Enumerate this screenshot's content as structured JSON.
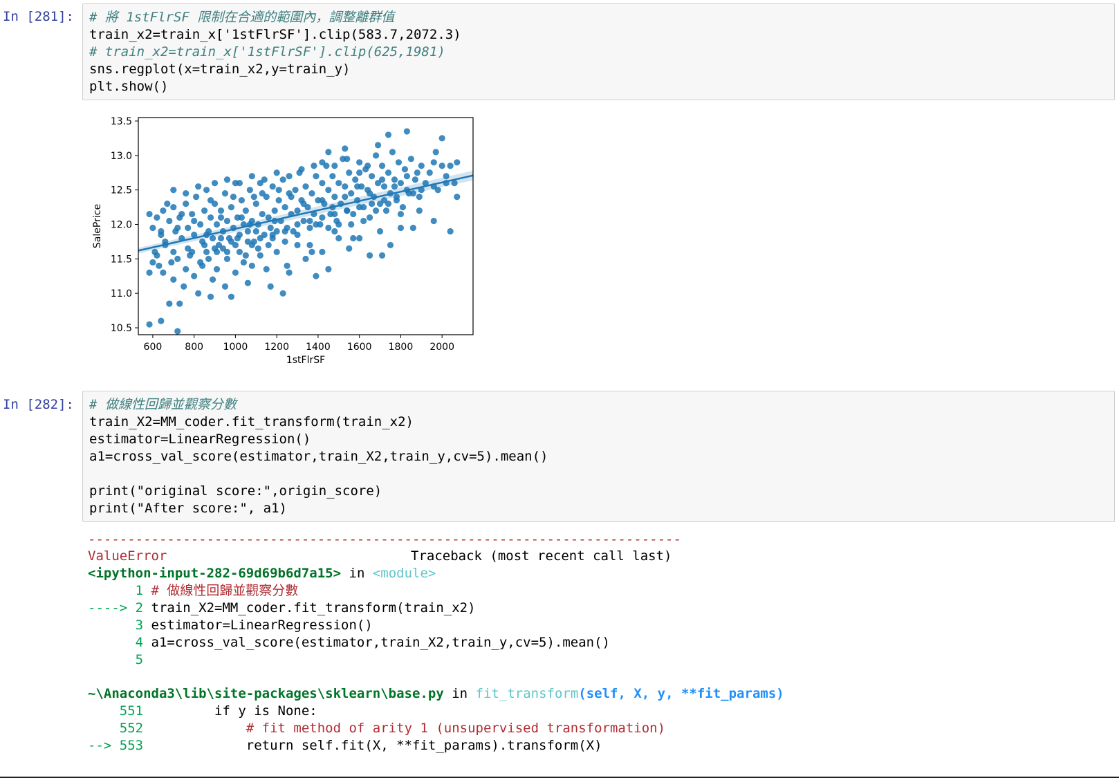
{
  "cell1": {
    "prompt": "In [281]:",
    "lines": [
      "# 將 1stFlrSF 限制在合適的範圍內，調整離群值",
      "train_x2=train_x['1stFlrSF'].clip(583.7,2072.3)",
      "# train_x2=train_x['1stFlrSF'].clip(625,1981)",
      "sns.regplot(x=train_x2,y=train_y)",
      "plt.show()"
    ]
  },
  "cell2": {
    "prompt": "In [282]:",
    "lines": [
      "# 做線性回歸並觀察分數",
      "train_X2=MM_coder.fit_transform(train_x2)",
      "estimator=LinearRegression()",
      "a1=cross_val_score(estimator,train_X2,train_y,cv=5).mean()",
      "",
      "print(\"original score:\",origin_score)",
      "print(\"After score:\", a1)"
    ]
  },
  "traceback": {
    "rule": "---------------------------------------------------------------------------",
    "error_name": "ValueError",
    "header_right": "Traceback (most recent call last)",
    "input_ref": "<ipython-input-282-69d69b6d7a15>",
    "in_word": "in",
    "module": "<module>",
    "frame1": [
      {
        "marker": "      1",
        "code": " # 做線性回歸並觀察分數"
      },
      {
        "marker": "----> 2",
        "code": " train_X2=MM_coder.fit_transform(train_x2)"
      },
      {
        "marker": "      3",
        "code": " estimator=LinearRegression()"
      },
      {
        "marker": "      4",
        "code": " a1=cross_val_score(estimator,train_X2,train_y,cv=5).mean()"
      },
      {
        "marker": "      5",
        "code": ""
      }
    ],
    "file_path": "~\\Anaconda3\\lib\\site-packages\\sklearn\\base.py",
    "func_name": "fit_transform",
    "func_args": "(self, X, y, **fit_params)",
    "frame2": [
      {
        "marker": "    551",
        "code": "         if y is None:"
      },
      {
        "marker": "    552",
        "code": "             # fit method of arity 1 (unsupervised transformation)"
      },
      {
        "marker": "--> 553",
        "code": "             return self.fit(X, **fit_params).transform(X)"
      }
    ]
  },
  "chart_data": {
    "type": "scatter",
    "xlabel": "1stFlrSF",
    "ylabel": "SalePrice",
    "xlim": [
      530,
      2150
    ],
    "ylim": [
      10.4,
      13.55
    ],
    "xticks": [
      600,
      800,
      1000,
      1200,
      1400,
      1600,
      1800,
      2000
    ],
    "yticks": [
      10.5,
      11.0,
      11.5,
      12.0,
      12.5,
      13.0,
      13.5
    ],
    "xticklabels": [
      "600",
      "800",
      "1000",
      "1200",
      "1400",
      "1600",
      "1800",
      "2000"
    ],
    "yticklabels": [
      "10.5",
      "11.0",
      "11.5",
      "12.0",
      "12.5",
      "13.0",
      "13.5"
    ],
    "regression_line": {
      "x": [
        530,
        2150
      ],
      "y": [
        11.62,
        12.71
      ]
    },
    "point_color": "#1f77b4",
    "points": [
      [
        583.7,
        10.55
      ],
      [
        640,
        10.6
      ],
      [
        720,
        10.45
      ],
      [
        680,
        10.85
      ],
      [
        730,
        10.85
      ],
      [
        880,
        10.95
      ],
      [
        980,
        10.95
      ],
      [
        1230,
        11.0
      ],
      [
        583.7,
        11.3
      ],
      [
        600,
        11.45
      ],
      [
        620,
        11.55
      ],
      [
        650,
        11.3
      ],
      [
        660,
        11.7
      ],
      [
        700,
        11.2
      ],
      [
        720,
        11.5
      ],
      [
        750,
        11.1
      ],
      [
        760,
        11.35
      ],
      [
        790,
        11.6
      ],
      [
        800,
        11.25
      ],
      [
        820,
        11.0
      ],
      [
        840,
        11.4
      ],
      [
        850,
        11.7
      ],
      [
        870,
        11.5
      ],
      [
        890,
        11.2
      ],
      [
        900,
        11.65
      ],
      [
        910,
        11.35
      ],
      [
        930,
        11.8
      ],
      [
        950,
        11.1
      ],
      [
        960,
        11.5
      ],
      [
        980,
        11.75
      ],
      [
        1000,
        11.3
      ],
      [
        1020,
        11.6
      ],
      [
        1040,
        11.45
      ],
      [
        1060,
        11.15
      ],
      [
        1080,
        11.7
      ],
      [
        1100,
        11.9
      ],
      [
        1120,
        11.55
      ],
      [
        1150,
        11.35
      ],
      [
        1180,
        11.8
      ],
      [
        1200,
        11.6
      ],
      [
        1250,
        11.4
      ],
      [
        1300,
        11.7
      ],
      [
        1340,
        11.5
      ],
      [
        1390,
        11.25
      ],
      [
        1420,
        11.6
      ],
      [
        1450,
        11.35
      ],
      [
        1500,
        11.8
      ],
      [
        1550,
        11.65
      ],
      [
        1600,
        11.8
      ],
      [
        1650,
        11.55
      ],
      [
        1700,
        11.9
      ],
      [
        1750,
        11.7
      ],
      [
        1800,
        11.95
      ],
      [
        583.7,
        12.15
      ],
      [
        600,
        11.95
      ],
      [
        620,
        12.1
      ],
      [
        640,
        11.85
      ],
      [
        650,
        12.2
      ],
      [
        660,
        11.75
      ],
      [
        680,
        12.05
      ],
      [
        700,
        12.25
      ],
      [
        710,
        11.9
      ],
      [
        730,
        12.1
      ],
      [
        740,
        11.8
      ],
      [
        760,
        12.3
      ],
      [
        770,
        11.95
      ],
      [
        790,
        12.15
      ],
      [
        800,
        11.85
      ],
      [
        810,
        12.4
      ],
      [
        830,
        12.0
      ],
      [
        840,
        11.75
      ],
      [
        850,
        12.2
      ],
      [
        860,
        12.5
      ],
      [
        870,
        11.9
      ],
      [
        880,
        12.1
      ],
      [
        890,
        11.8
      ],
      [
        900,
        12.3
      ],
      [
        910,
        12.0
      ],
      [
        920,
        11.7
      ],
      [
        930,
        12.2
      ],
      [
        940,
        11.9
      ],
      [
        950,
        12.45
      ],
      [
        960,
        12.05
      ],
      [
        970,
        11.8
      ],
      [
        980,
        12.25
      ],
      [
        990,
        11.95
      ],
      [
        1000,
        12.6
      ],
      [
        1010,
        12.1
      ],
      [
        1020,
        11.85
      ],
      [
        1030,
        12.35
      ],
      [
        1040,
        12.0
      ],
      [
        1050,
        12.2
      ],
      [
        1060,
        11.9
      ],
      [
        1070,
        12.5
      ],
      [
        1080,
        12.05
      ],
      [
        1090,
        11.75
      ],
      [
        1100,
        12.3
      ],
      [
        1110,
        12.0
      ],
      [
        1120,
        12.6
      ],
      [
        1130,
        12.15
      ],
      [
        1140,
        11.85
      ],
      [
        1150,
        12.4
      ],
      [
        1160,
        12.1
      ],
      [
        1170,
        11.95
      ],
      [
        1180,
        12.55
      ],
      [
        1190,
        12.2
      ],
      [
        1200,
        11.9
      ],
      [
        1210,
        12.35
      ],
      [
        1220,
        12.05
      ],
      [
        1230,
        12.65
      ],
      [
        1240,
        12.25
      ],
      [
        1250,
        11.95
      ],
      [
        1260,
        12.45
      ],
      [
        1270,
        12.15
      ],
      [
        1280,
        11.9
      ],
      [
        1290,
        12.5
      ],
      [
        1300,
        12.2
      ],
      [
        1310,
        12.75
      ],
      [
        1320,
        12.35
      ],
      [
        1330,
        12.05
      ],
      [
        1340,
        12.55
      ],
      [
        1350,
        12.25
      ],
      [
        1360,
        11.95
      ],
      [
        1370,
        12.45
      ],
      [
        1380,
        12.15
      ],
      [
        1390,
        12.7
      ],
      [
        1400,
        12.35
      ],
      [
        1410,
        12.0
      ],
      [
        1420,
        12.6
      ],
      [
        1430,
        12.3
      ],
      [
        1440,
        12.85
      ],
      [
        1450,
        12.5
      ],
      [
        1460,
        12.15
      ],
      [
        1470,
        12.7
      ],
      [
        1480,
        12.4
      ],
      [
        1490,
        12.05
      ],
      [
        1500,
        12.6
      ],
      [
        1510,
        12.3
      ],
      [
        1520,
        12.95
      ],
      [
        1530,
        12.55
      ],
      [
        1540,
        12.2
      ],
      [
        1550,
        12.75
      ],
      [
        1560,
        12.45
      ],
      [
        1570,
        12.15
      ],
      [
        1580,
        12.65
      ],
      [
        1590,
        12.35
      ],
      [
        1600,
        12.9
      ],
      [
        1610,
        12.55
      ],
      [
        1620,
        12.25
      ],
      [
        1630,
        12.8
      ],
      [
        1640,
        12.5
      ],
      [
        1650,
        12.1
      ],
      [
        1660,
        12.7
      ],
      [
        1670,
        12.4
      ],
      [
        1680,
        13.0
      ],
      [
        1690,
        12.6
      ],
      [
        1700,
        12.3
      ],
      [
        1710,
        12.85
      ],
      [
        1720,
        12.55
      ],
      [
        1730,
        12.2
      ],
      [
        1740,
        12.75
      ],
      [
        1750,
        12.45
      ],
      [
        1760,
        13.05
      ],
      [
        1770,
        12.65
      ],
      [
        1780,
        12.35
      ],
      [
        1790,
        12.9
      ],
      [
        1800,
        12.6
      ],
      [
        1810,
        12.25
      ],
      [
        1820,
        12.8
      ],
      [
        1830,
        12.5
      ],
      [
        1850,
        12.95
      ],
      [
        1870,
        12.65
      ],
      [
        1890,
        12.4
      ],
      [
        1900,
        12.85
      ],
      [
        1920,
        12.6
      ],
      [
        1940,
        12.75
      ],
      [
        1960,
        12.9
      ],
      [
        1980,
        12.5
      ],
      [
        2000,
        12.85
      ],
      [
        2020,
        12.7
      ],
      [
        2040,
        12.85
      ],
      [
        2060,
        12.6
      ],
      [
        2072.3,
        12.9
      ],
      [
        2072.3,
        12.4
      ],
      [
        2040,
        11.9
      ],
      [
        1960,
        12.05
      ],
      [
        1740,
        13.3
      ],
      [
        1830,
        13.35
      ],
      [
        2000,
        13.25
      ],
      [
        1970,
        13.05
      ],
      [
        1530,
        13.1
      ],
      [
        1450,
        13.05
      ],
      [
        1690,
        13.15
      ],
      [
        1890,
        12.2
      ],
      [
        1860,
        11.95
      ],
      [
        1710,
        11.55
      ],
      [
        1570,
        11.8
      ],
      [
        1480,
        11.9
      ],
      [
        1370,
        11.6
      ],
      [
        1260,
        11.3
      ],
      [
        1170,
        11.1
      ],
      [
        1080,
        11.4
      ],
      [
        640,
        11.9
      ],
      [
        700,
        12.5
      ],
      [
        760,
        12.45
      ],
      [
        820,
        12.55
      ],
      [
        900,
        12.6
      ],
      [
        960,
        12.65
      ],
      [
        1020,
        12.6
      ],
      [
        1080,
        12.7
      ],
      [
        1140,
        12.65
      ],
      [
        1200,
        12.75
      ],
      [
        1260,
        12.7
      ],
      [
        1320,
        12.8
      ],
      [
        1380,
        12.85
      ],
      [
        1420,
        12.9
      ],
      [
        1480,
        12.85
      ],
      [
        1540,
        12.95
      ],
      [
        1600,
        12.75
      ],
      [
        1640,
        12.85
      ],
      [
        700,
        11.6
      ],
      [
        780,
        11.55
      ],
      [
        860,
        11.6
      ],
      [
        940,
        11.65
      ],
      [
        1000,
        11.7
      ],
      [
        1060,
        11.75
      ],
      [
        1120,
        11.8
      ],
      [
        1180,
        11.85
      ],
      [
        1240,
        11.9
      ],
      [
        1300,
        12.0
      ],
      [
        1360,
        12.05
      ],
      [
        1420,
        12.1
      ],
      [
        1480,
        12.15
      ],
      [
        1540,
        12.2
      ],
      [
        1600,
        12.25
      ],
      [
        1660,
        12.3
      ],
      [
        1720,
        12.35
      ],
      [
        1780,
        12.4
      ],
      [
        1840,
        12.45
      ],
      [
        1900,
        12.5
      ],
      [
        1960,
        12.55
      ],
      [
        2020,
        12.6
      ],
      [
        610,
        11.6
      ],
      [
        630,
        11.4
      ],
      [
        670,
        12.3
      ],
      [
        690,
        11.45
      ],
      [
        720,
        11.95
      ],
      [
        740,
        12.15
      ],
      [
        770,
        11.65
      ],
      [
        800,
        12.05
      ],
      [
        830,
        11.45
      ],
      [
        860,
        11.85
      ],
      [
        880,
        12.35
      ],
      [
        910,
        11.6
      ],
      [
        930,
        12.1
      ],
      [
        960,
        11.6
      ],
      [
        990,
        12.4
      ],
      [
        1010,
        11.8
      ],
      [
        1030,
        12.1
      ],
      [
        1050,
        11.55
      ],
      [
        1070,
        12.0
      ],
      [
        1090,
        12.4
      ],
      [
        1110,
        11.65
      ],
      [
        1130,
        12.45
      ],
      [
        1160,
        11.7
      ],
      [
        1190,
        12.05
      ],
      [
        1210,
        12.5
      ],
      [
        1240,
        11.75
      ],
      [
        1270,
        12.4
      ],
      [
        1300,
        11.85
      ],
      [
        1330,
        12.3
      ],
      [
        1360,
        11.7
      ],
      [
        1390,
        12.0
      ],
      [
        1420,
        12.35
      ],
      [
        1450,
        11.95
      ],
      [
        1470,
        12.25
      ],
      [
        1500,
        12.0
      ],
      [
        1530,
        12.4
      ],
      [
        1560,
        12.0
      ],
      [
        1590,
        12.55
      ],
      [
        1620,
        12.05
      ],
      [
        1650,
        12.45
      ],
      [
        1680,
        12.2
      ],
      [
        1710,
        12.65
      ],
      [
        1740,
        12.3
      ],
      [
        1770,
        12.55
      ],
      [
        1800,
        12.15
      ],
      [
        1830,
        12.7
      ],
      [
        1860,
        12.45
      ],
      [
        1880,
        12.75
      ]
    ]
  }
}
